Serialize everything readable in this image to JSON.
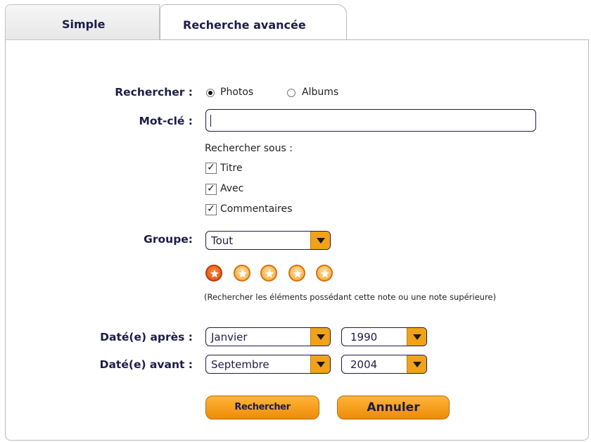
{
  "tabs": [
    {
      "label": "Simple",
      "active": false
    },
    {
      "label": "Recherche avancée",
      "active": true
    }
  ],
  "search": {
    "label": "Rechercher :",
    "options": [
      {
        "label": "Photos",
        "selected": true
      },
      {
        "label": "Albums",
        "selected": false
      }
    ]
  },
  "keyword": {
    "label": "Mot-clé :",
    "value": ""
  },
  "search_under": {
    "label": "Rechercher sous :",
    "items": [
      {
        "label": "Titre",
        "checked": true
      },
      {
        "label": "Avec",
        "checked": true
      },
      {
        "label": "Commentaires",
        "checked": true
      }
    ]
  },
  "group": {
    "label": "Groupe:",
    "selected": "Tout"
  },
  "rating": {
    "value": 1,
    "max": 5,
    "hint": "(Rechercher les éléments possédant cette note ou une note supérieure)"
  },
  "date_after": {
    "label": "Daté(e) après :",
    "month": "Janvier",
    "year": "1990"
  },
  "date_before": {
    "label": "Daté(e) avant :",
    "month": "Septembre",
    "year": "2004"
  },
  "buttons": {
    "search": "Rechercher",
    "cancel": "Annuler"
  },
  "colors": {
    "accent": "#f0a21a",
    "text": "#1d1d48",
    "active_star": "#ec5b16"
  }
}
